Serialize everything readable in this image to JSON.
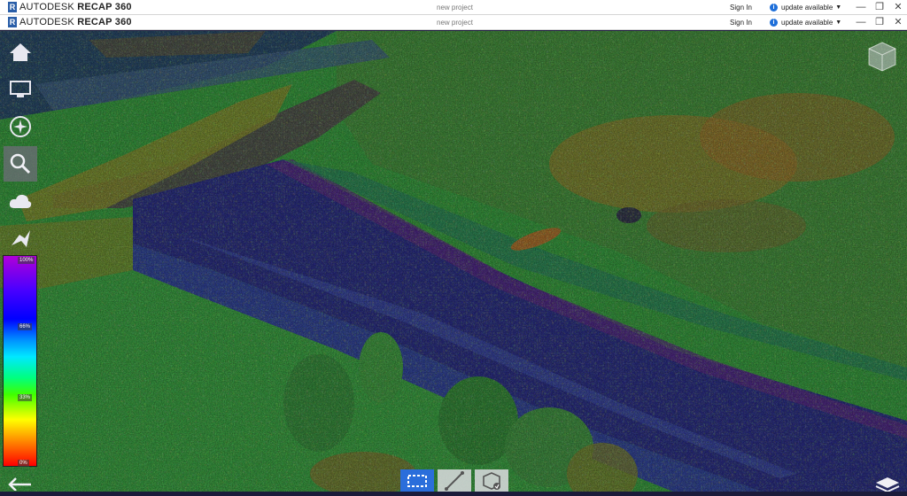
{
  "window": {
    "app_brand": "AUTODESK",
    "app_product": "RECAP 360",
    "project_name": "new project",
    "sign_in_label": "Sign In",
    "update_label": "update available"
  },
  "toolbar": {
    "items": [
      {
        "name": "home",
        "icon": "home-icon"
      },
      {
        "name": "display",
        "icon": "monitor-icon"
      },
      {
        "name": "navigate",
        "icon": "compass-icon"
      },
      {
        "name": "search",
        "icon": "search-icon",
        "active": true
      },
      {
        "name": "cloud",
        "icon": "cloud-icon"
      },
      {
        "name": "share",
        "icon": "share-icon"
      }
    ]
  },
  "legend": {
    "top_label": "100%",
    "mid_label": "66%",
    "low_label": "33%",
    "bottom_label": "0%"
  },
  "bottom_tools": [
    {
      "name": "box-select",
      "icon": "box-select-icon",
      "selected": true
    },
    {
      "name": "measure",
      "icon": "measure-icon"
    },
    {
      "name": "clip",
      "icon": "clip-icon"
    }
  ],
  "colors": {
    "accent": "#2a6edb",
    "brand": "#2a5ea8",
    "info": "#1e6fd9"
  }
}
